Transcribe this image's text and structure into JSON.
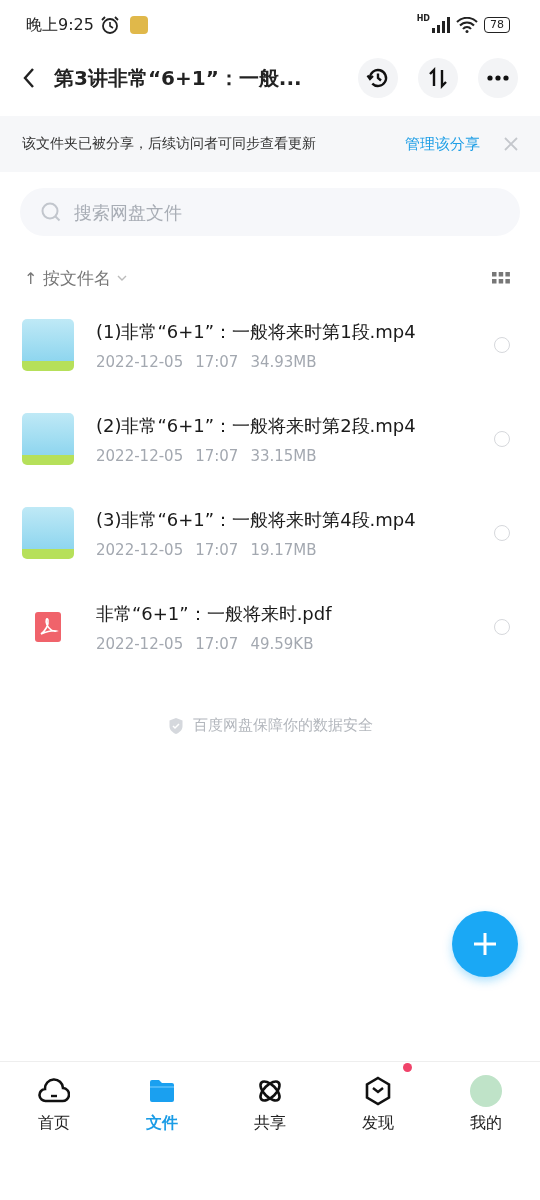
{
  "status_bar": {
    "time": "晚上9:25",
    "network": "HD",
    "battery": "78"
  },
  "header": {
    "title": "第3讲非常“6+1”：一般..."
  },
  "share_banner": {
    "text": "该文件夹已被分享，后续访问者可同步查看更新",
    "link": "管理该分享"
  },
  "search": {
    "placeholder": "搜索网盘文件"
  },
  "sort": {
    "arrow": "↑",
    "label": "按文件名"
  },
  "files": [
    {
      "kind": "video",
      "name": "(1)非常“6+1”：一般将来时第1段.mp4",
      "date": "2022-12-05",
      "time": "17:07",
      "size": "34.93MB",
      "selected": false
    },
    {
      "kind": "video",
      "name": "(2)非常“6+1”：一般将来时第2段.mp4",
      "date": "2022-12-05",
      "time": "17:07",
      "size": "33.15MB",
      "selected": false
    },
    {
      "kind": "video",
      "name": "(3)非常“6+1”：一般将来时第4段.mp4",
      "date": "2022-12-05",
      "time": "17:07",
      "size": "19.17MB",
      "selected": false
    },
    {
      "kind": "pdf",
      "name": "非常“6+1”：一般将来时.pdf",
      "date": "2022-12-05",
      "time": "17:07",
      "size": "49.59KB",
      "selected": false
    }
  ],
  "footer_note": "百度网盘保障你的数据安全",
  "tabs": [
    {
      "kind": "home",
      "label": "首页",
      "selected": false,
      "dot": false
    },
    {
      "kind": "files",
      "label": "文件",
      "selected": true,
      "dot": false
    },
    {
      "kind": "share",
      "label": "共享",
      "selected": false,
      "dot": false
    },
    {
      "kind": "discover",
      "label": "发现",
      "selected": false,
      "dot": true
    },
    {
      "kind": "me",
      "label": "我的",
      "selected": false,
      "dot": false
    }
  ]
}
